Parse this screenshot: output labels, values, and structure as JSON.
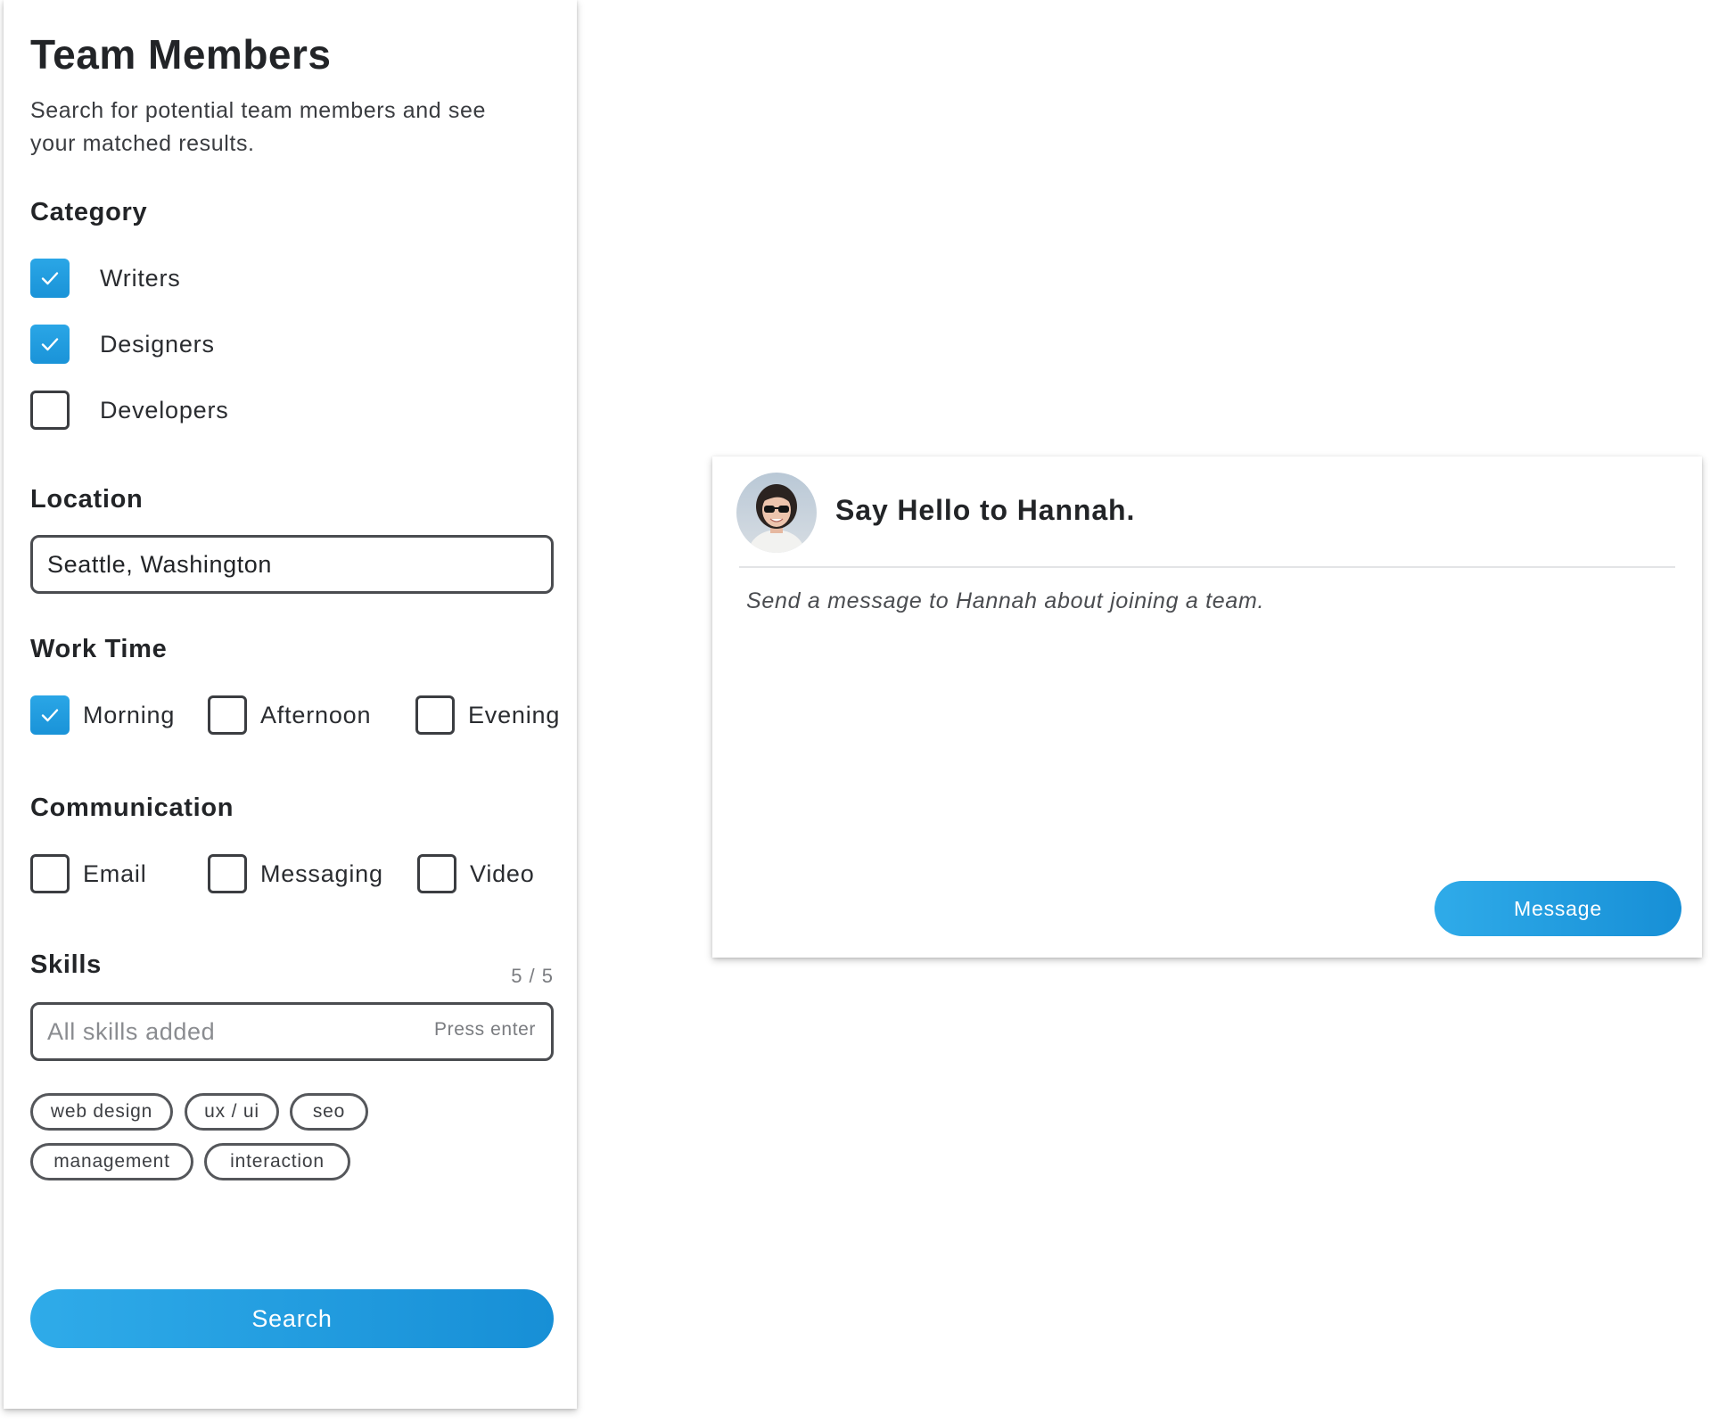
{
  "panel": {
    "title": "Team Members",
    "description": "Search for potential team members and see your matched results.",
    "category": {
      "label": "Category",
      "options": [
        {
          "label": "Writers",
          "checked": true
        },
        {
          "label": "Designers",
          "checked": true
        },
        {
          "label": "Developers",
          "checked": false
        }
      ]
    },
    "location": {
      "label": "Location",
      "value": "Seattle, Washington"
    },
    "work_time": {
      "label": "Work Time",
      "options": [
        {
          "label": "Morning",
          "checked": true
        },
        {
          "label": "Afternoon",
          "checked": false
        },
        {
          "label": "Evening",
          "checked": false
        }
      ]
    },
    "communication": {
      "label": "Communication",
      "options": [
        {
          "label": "Email",
          "checked": false
        },
        {
          "label": "Messaging",
          "checked": false
        },
        {
          "label": "Video",
          "checked": false
        }
      ]
    },
    "skills": {
      "label": "Skills",
      "count": "5 / 5",
      "placeholder": "All skills added",
      "hint": "Press enter",
      "tags": [
        "web design",
        "ux / ui",
        "seo",
        "management",
        "interaction"
      ]
    },
    "search_label": "Search"
  },
  "card": {
    "title": "Say Hello to Hannah.",
    "message_placeholder": "Send a message to Hannah about joining a team.",
    "button_label": "Message"
  },
  "colors": {
    "accent": "#1f9bdf",
    "text": "#222427",
    "border": "#4a4c50"
  },
  "icons": {
    "check": "check-icon",
    "avatar": "avatar"
  }
}
